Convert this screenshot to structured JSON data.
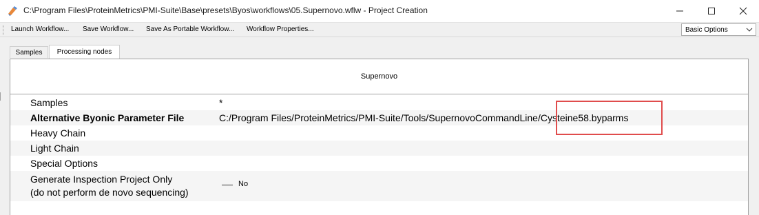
{
  "window": {
    "title": "C:\\Program Files\\ProteinMetrics\\PMI-Suite\\Base\\presets\\Byos\\workflows\\05.Supernovo.wflw - Project Creation"
  },
  "toolbar": {
    "launch_label": "Launch Workflow...",
    "save_label": "Save Workflow...",
    "portable_label": "Save As Portable Workflow...",
    "properties_label": "Workflow Properties...",
    "options_selected": "Basic Options"
  },
  "tabs": [
    {
      "label": "Samples"
    },
    {
      "label": "Processing nodes"
    }
  ],
  "panel": {
    "title": "Supernovo",
    "rows": [
      {
        "name": "Samples",
        "value": "*"
      },
      {
        "name": "Alternative Byonic Parameter File",
        "value": "C:/Program Files/ProteinMetrics/PMI-Suite/Tools/SupernovoCommandLine/Cysteine58.byparms"
      },
      {
        "name": "Heavy Chain",
        "value": ""
      },
      {
        "name": "Light Chain",
        "value": ""
      },
      {
        "name": "Special Options",
        "value": ""
      },
      {
        "name_line1": "Generate Inspection Project Only",
        "name_line2": "(do not perform de novo sequencing)",
        "value": "No"
      }
    ]
  },
  "colors": {
    "highlight": "#e04c4c",
    "toolbar_bg": "#f0f0f0",
    "alt_row": "#f5f5f5"
  },
  "icons": {
    "app": "pmi-app-icon",
    "minimize": "minimize-icon",
    "maximize": "maximize-icon",
    "close": "close-icon",
    "dropdown": "chevron-down-icon"
  }
}
